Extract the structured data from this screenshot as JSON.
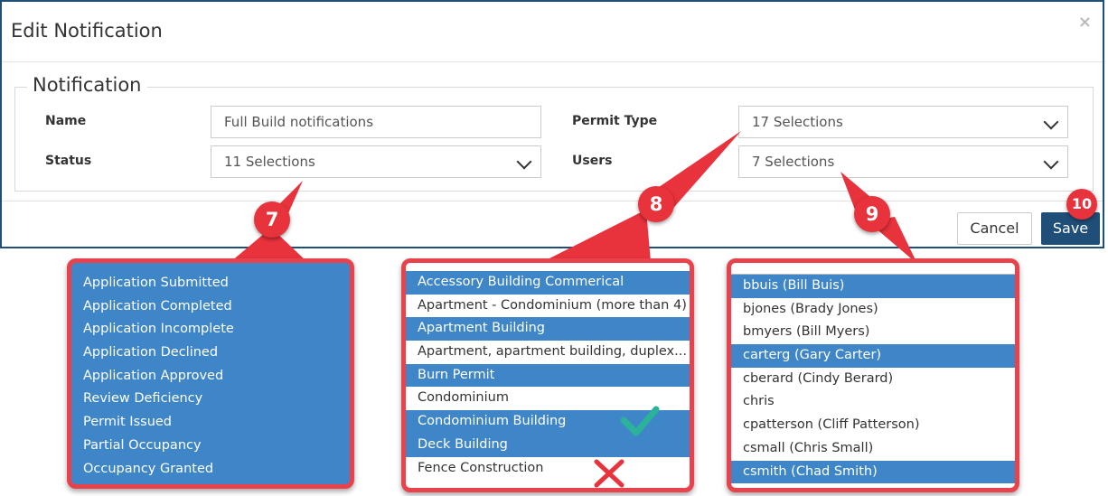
{
  "modal": {
    "title": "Edit Notification",
    "close_glyph": "×",
    "section_title": "Notification",
    "fields": {
      "name_label": "Name",
      "name_value": "Full Build notifications",
      "status_label": "Status",
      "status_value": "11 Selections",
      "permit_type_label": "Permit Type",
      "permit_type_value": "17 Selections",
      "users_label": "Users",
      "users_value": "7 Selections"
    },
    "buttons": {
      "cancel": "Cancel",
      "save": "Save"
    }
  },
  "callouts": {
    "c7": "7",
    "c8": "8",
    "c9": "9",
    "c10": "10"
  },
  "status_list": [
    "Application Submitted",
    "Application Completed",
    "Application Incomplete",
    "Application Declined",
    "Application Approved",
    "Review Deficiency",
    "Permit Issued",
    "Partial Occupancy",
    "Occupancy Granted"
  ],
  "permit_list": [
    {
      "label": "Accessory Building Commerical",
      "selected": true
    },
    {
      "label": "Apartment - Condominium (more than 4)",
      "selected": false
    },
    {
      "label": "Apartment Building",
      "selected": true
    },
    {
      "label": "Apartment, apartment building, duplex...",
      "selected": false
    },
    {
      "label": "Burn Permit",
      "selected": true
    },
    {
      "label": "Condominium",
      "selected": false
    },
    {
      "label": "Condominium Building",
      "selected": true
    },
    {
      "label": "Deck Building",
      "selected": true
    },
    {
      "label": "Fence Construction",
      "selected": false
    }
  ],
  "users_list": [
    {
      "label": "bbuis (Bill Buis)",
      "selected": true
    },
    {
      "label": "bjones (Brady Jones)",
      "selected": false
    },
    {
      "label": "bmyers (Bill Myers)",
      "selected": false
    },
    {
      "label": "carterg (Gary Carter)",
      "selected": true
    },
    {
      "label": "cberard (Cindy Berard)",
      "selected": false
    },
    {
      "label": "chris",
      "selected": false
    },
    {
      "label": "cpatterson (Cliff Patterson)",
      "selected": false
    },
    {
      "label": "csmall (Chris Small)",
      "selected": false
    },
    {
      "label": "csmith (Chad Smith)",
      "selected": true
    }
  ],
  "colors": {
    "selected_bg": "#3e86c8",
    "callout_red": "#e8323c",
    "modal_border": "#1f4e79",
    "check_green": "#2bb39a"
  }
}
